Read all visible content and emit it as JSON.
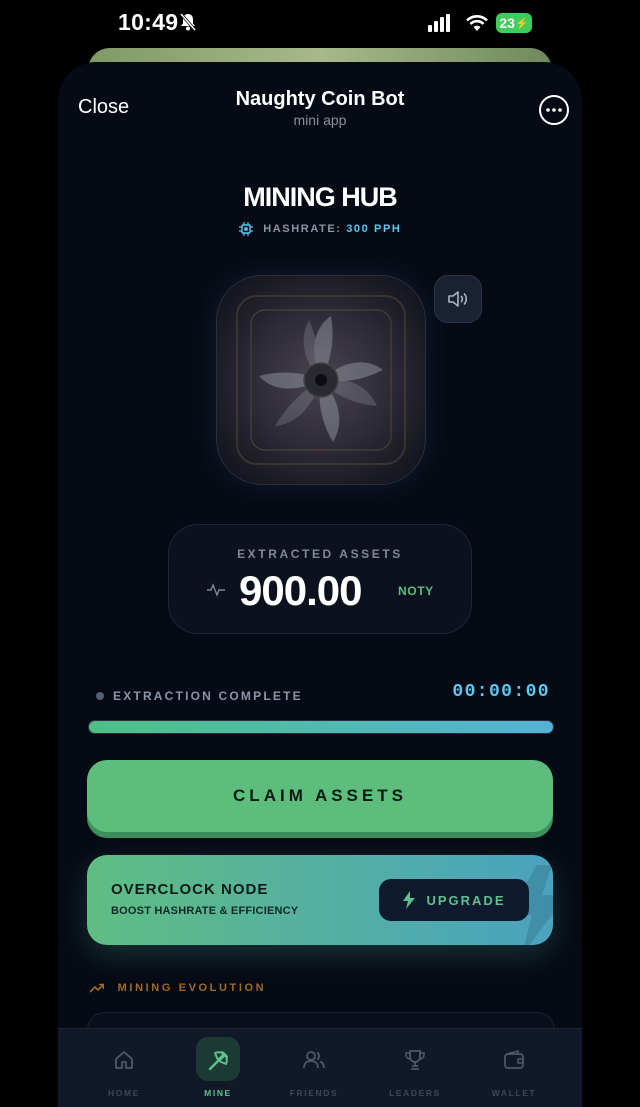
{
  "status_bar": {
    "time": "10:49",
    "battery": "23"
  },
  "header": {
    "close_label": "Close",
    "app_name": "Naughty Coin Bot",
    "app_subtitle": "mini app"
  },
  "hub": {
    "title": "MINING HUB",
    "hashrate_label": "HASHRATE:",
    "hashrate_value": "300 PPH"
  },
  "assets": {
    "label": "EXTRACTED ASSETS",
    "value": "900.00",
    "unit": "NOTY"
  },
  "extraction": {
    "status": "EXTRACTION COMPLETE",
    "timer": "00:00:00",
    "progress_fraction": 1.0
  },
  "claim_label": "CLAIM ASSETS",
  "overclock": {
    "title": "OVERCLOCK NODE",
    "subtitle": "BOOST HASHRATE & EFFICIENCY",
    "upgrade_label": "UPGRADE"
  },
  "evolution_label": "MINING EVOLUTION",
  "nav": [
    {
      "label": "HOME",
      "icon": "home-icon",
      "active": false
    },
    {
      "label": "MINE",
      "icon": "pickaxe-icon",
      "active": true
    },
    {
      "label": "FRIENDS",
      "icon": "friends-icon",
      "active": false
    },
    {
      "label": "LEADERS",
      "icon": "trophy-icon",
      "active": false
    },
    {
      "label": "WALLET",
      "icon": "wallet-icon",
      "active": false
    }
  ],
  "colors": {
    "accent_green": "#5dbd7d",
    "accent_blue": "#5ec8f2",
    "background": "#060a14"
  }
}
